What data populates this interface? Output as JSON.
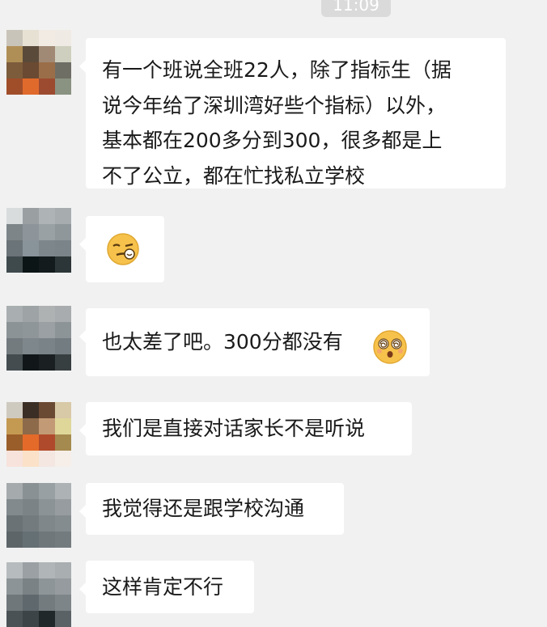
{
  "chat": {
    "timestamp": "11:09",
    "messages": [
      {
        "type": "text",
        "lines": [
          "有一个班说全班22人，除了指标生（据",
          "说今年给了深圳湾好些个指标）以外，",
          "基本都在200多分到300，很多都是上",
          "不了公立，都在忙找私立学校"
        ]
      },
      {
        "type": "emoji",
        "emoji": "smirk-wink-emoji"
      },
      {
        "type": "text_emoji",
        "text": "也太差了吧。300分都没有",
        "emoji": "dizzy-face-emoji"
      },
      {
        "type": "text",
        "text": "我们是直接对话家长不是听说"
      },
      {
        "type": "text",
        "text": "我觉得还是跟学校沟通"
      },
      {
        "type": "text",
        "text": "这样肯定不行"
      }
    ]
  },
  "colors": {
    "background": "#f1f1f1",
    "bubble": "#ffffff",
    "text": "#1a1a1a",
    "timestamp_pill": "#dadada"
  }
}
